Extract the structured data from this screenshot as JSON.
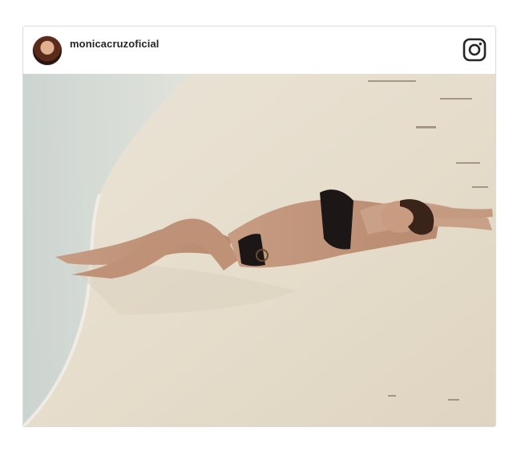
{
  "post": {
    "username": "monicacruzoficial",
    "avatar_icon": "profile-photo-avatar",
    "brand_icon": "instagram-icon",
    "image_subject": "woman-lying-on-beach-photo",
    "colors": {
      "border": "#dbdbdb",
      "username": "#262626",
      "sand": "#ece4d6",
      "water": "#cfd9d6"
    }
  }
}
